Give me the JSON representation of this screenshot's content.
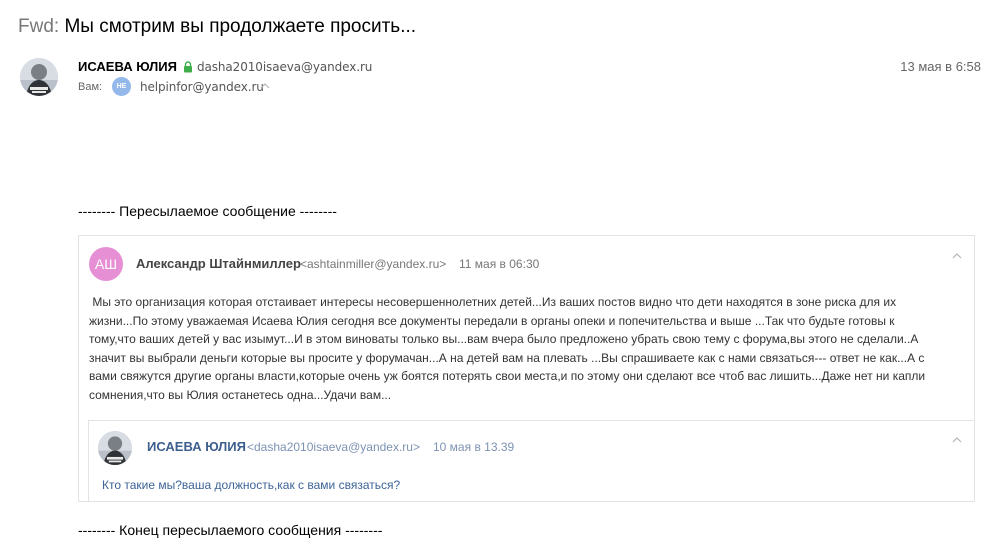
{
  "email": {
    "subject_prefix": "Fwd:",
    "subject": "Мы смотрим вы продолжаете просить...",
    "sender": {
      "name": "ИСАЕВА ЮЛИЯ",
      "email": "dasha2010isaeva@yandex.ru",
      "avatar": "user-photo-avatar"
    },
    "date": "13 мая в 6:58",
    "to_label": "Вам:",
    "recipient": {
      "badge": "HE",
      "badge_color": "#95b8ea",
      "email": "helpinfor@yandex.ru"
    },
    "forward_header": "-------- Пересылаемое сообщение --------",
    "forward_footer": "-------- Конец пересылаемого сообщения --------"
  },
  "quoted": {
    "avatar_initials": "АШ",
    "avatar_color": "#e68fd5",
    "name": "Александр Штайнмиллер",
    "email": "<ashtainmiller@yandex.ru>",
    "date": "11 мая в 06:30",
    "body_lines": [
      " Мы это организация которая отстаивает интересы несовершеннолетних детей...Из ваших постов видно что дети находятся в зоне риска для их",
      "жизни...По этому уважаемая Исаева Юлия сегодня все документы передали в органы опеки и попечительства и выше ...Так что будьте готовы к",
      "тому,что ваших детей у вас изымут...И в этом виноваты только вы...вам вчера было предложено убрать свою тему с форума,вы этого не сделали..А",
      "значит вы выбрали деньги которые вы просите у форумачан...А на детей вам на плевать ...Вы спрашиваете как с нами связаться--- ответ не как...А с",
      "вами свяжутся другие органы власти,которые очень уж боятся потерять свои места,и по этому они сделают все чтоб вас лишить...Даже нет ни капли",
      "сомнения,что вы Юлия останетесь одна...Удачи вам..."
    ]
  },
  "nested": {
    "name": "ИСАЕВА ЮЛИЯ",
    "email": "<dasha2010isaeva@yandex.ru>",
    "date": "10 мая в 13.39",
    "body": "Кто такие мы?ваша должность,как с вами связаться?"
  }
}
